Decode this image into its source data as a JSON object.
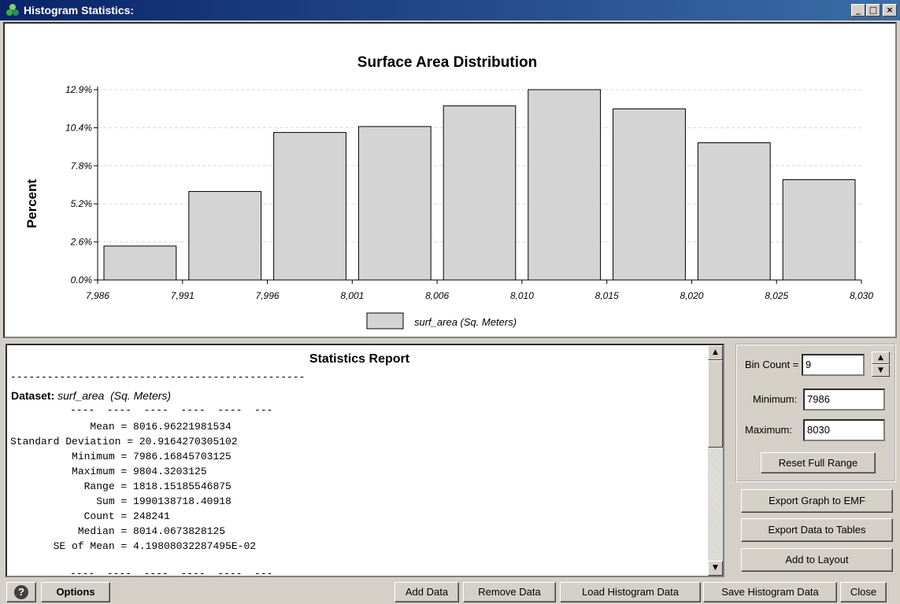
{
  "window": {
    "title": "Histogram Statistics:",
    "minimize_glyph": "_",
    "maximize_glyph": "□",
    "close_glyph": "×"
  },
  "chart_data": {
    "type": "bar",
    "title": "Surface Area Distribution",
    "ylabel": "Percent",
    "xlabel": "",
    "x_tick_labels": [
      "7,986",
      "7,991",
      "7,996",
      "8,001",
      "8,006",
      "8,010",
      "8,015",
      "8,020",
      "8,025",
      "8,030"
    ],
    "y_tick_labels": [
      "0.0%",
      "2.6%",
      "5.2%",
      "7.8%",
      "10.4%",
      "12.9%"
    ],
    "ylim": [
      0,
      12.9
    ],
    "bin_edges": [
      7986,
      7990.89,
      7995.78,
      8000.67,
      8005.56,
      8010.44,
      8015.33,
      8020.22,
      8025.11,
      8030
    ],
    "series": [
      {
        "name": "surf_area  (Sq. Meters)",
        "values": [
          2.3,
          6.0,
          10.0,
          10.4,
          11.8,
          12.9,
          11.6,
          9.3,
          6.8
        ]
      }
    ],
    "legend_position": "bottom",
    "grid": true,
    "bar_color": "#d4d4d4"
  },
  "report": {
    "title": "Statistics Report",
    "separator": "------------------------------------------------",
    "dataset_label": "Dataset:",
    "dataset_name": "surf_area  (Sq. Meters)",
    "dashes": "----  ----  ----  ----  ----  ---",
    "dashes_bottom": "----  ----  ----  ----  ----  ---",
    "lines": [
      "             Mean = 8016.96221981534",
      "Standard Deviation = 20.9164270305102",
      "          Minimum = 7986.16845703125",
      "          Maximum = 9804.3203125",
      "            Range = 1818.15185546875",
      "              Sum = 1990138718.40918",
      "            Count = 248241",
      "           Median = 8014.0673828125",
      "       SE of Mean = 4.19808032287495E-02"
    ],
    "scroll_up": "▲",
    "scroll_down": "▼"
  },
  "controls": {
    "bin_count_label": "Bin Count =",
    "bin_count_value": "9",
    "minimum_label": "Minimum:",
    "minimum_value": "7986",
    "maximum_label": "Maximum:",
    "maximum_value": "8030",
    "reset_label": "Reset Full Range",
    "spin_up": "▲",
    "spin_down": "▼"
  },
  "side_buttons": {
    "export_emf": "Export Graph to EMF",
    "export_tables": "Export Data to Tables",
    "add_layout": "Add to Layout"
  },
  "bottom_bar": {
    "help": "?",
    "options": "Options",
    "add_data": "Add Data",
    "remove_data": "Remove Data",
    "load_histogram": "Load Histogram Data",
    "save_histogram": "Save Histogram Data",
    "close": "Close"
  },
  "colors": {
    "titlebar_start": "#0a246a",
    "titlebar_end": "#3a6ea5",
    "face": "#d4d0c8"
  }
}
